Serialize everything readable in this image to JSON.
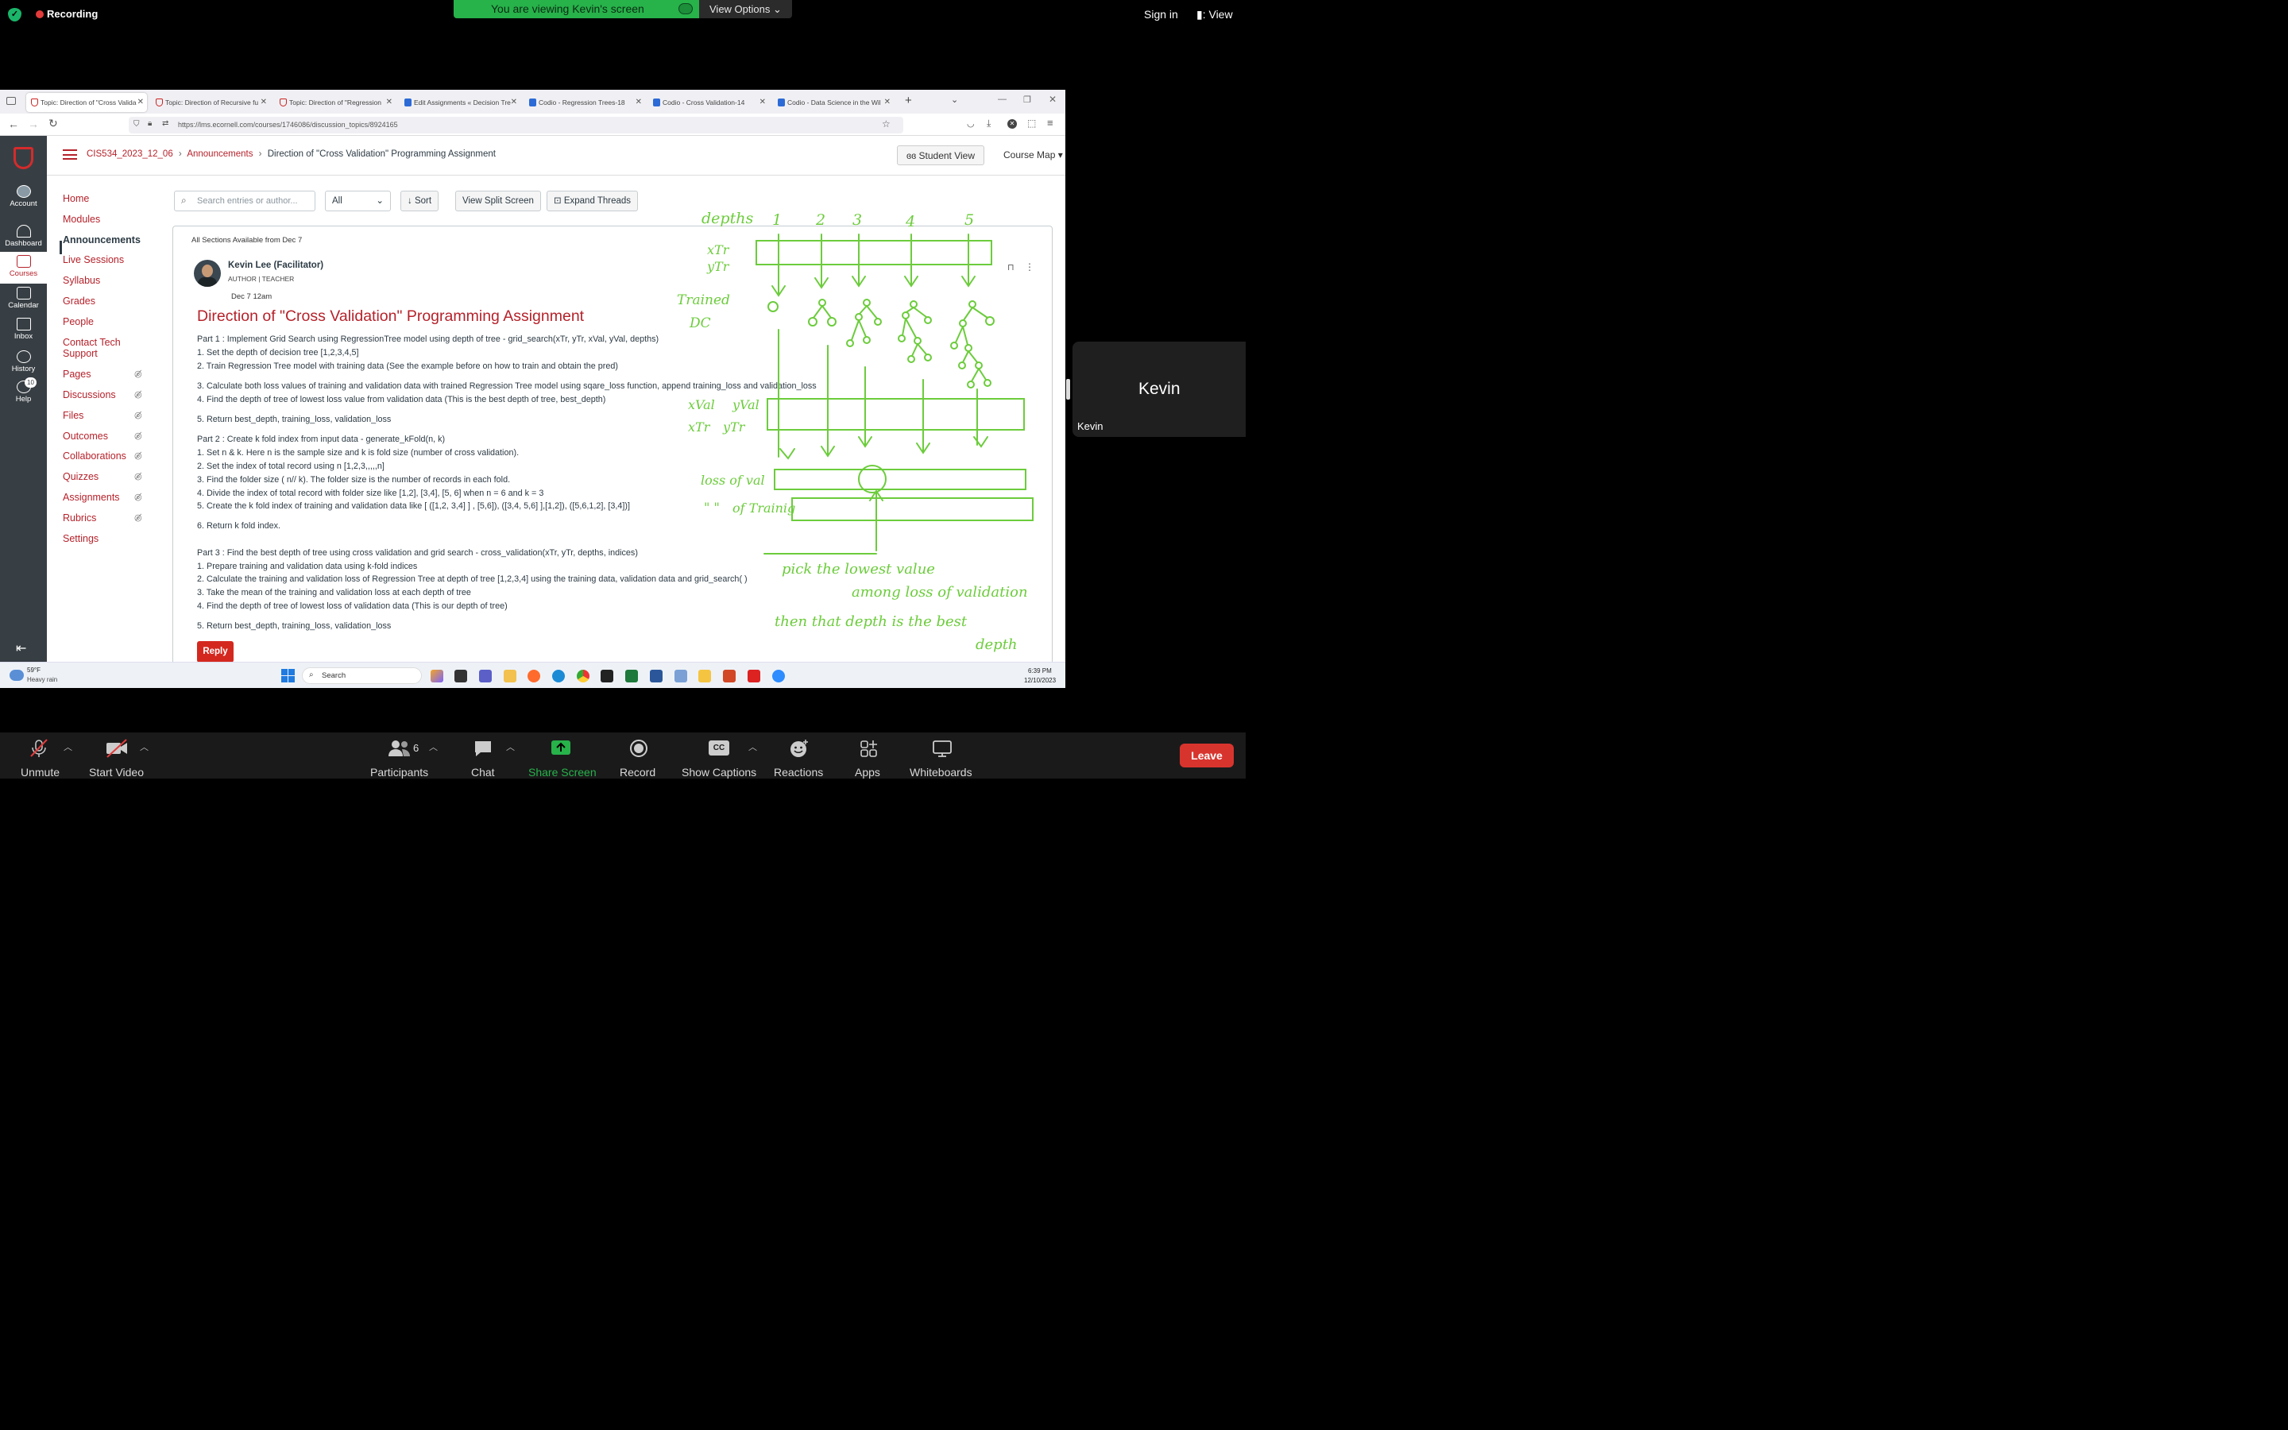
{
  "zoom": {
    "recording": "Recording",
    "banner": "You are viewing Kevin's screen",
    "view_options": "View Options",
    "sign_in": "Sign in",
    "view": "View",
    "kevin_tile_name": "Kevin",
    "kevin_tile_label": "Kevin",
    "controls": {
      "unmute": "Unmute",
      "start_video": "Start Video",
      "participants": "Participants",
      "participants_count": "6",
      "chat": "Chat",
      "share_screen": "Share Screen",
      "record": "Record",
      "show_captions": "Show Captions",
      "captions_badge": "CC",
      "reactions": "Reactions",
      "apps": "Apps",
      "whiteboards": "Whiteboards",
      "leave": "Leave"
    }
  },
  "browser": {
    "tabs": [
      {
        "label": "Topic: Direction of \"Cross Valida"
      },
      {
        "label": "Topic: Direction of Recursive fu"
      },
      {
        "label": "Topic: Direction of \"Regression"
      },
      {
        "label": "Edit Assignments « Decision Tre"
      },
      {
        "label": "Codio - Regression Trees-18"
      },
      {
        "label": "Codio - Cross Validation-14"
      },
      {
        "label": "Codio - Data Science in the Wil"
      }
    ],
    "url": "https://lms.ecornell.com/courses/1746086/discussion_topics/8924165"
  },
  "canvas": {
    "global_nav": [
      "Account",
      "Dashboard",
      "Courses",
      "Calendar",
      "Inbox",
      "History",
      "Help"
    ],
    "help_badge": "10",
    "breadcrumb": {
      "course": "CIS534_2023_12_06",
      "section": "Announcements",
      "page": "Direction of \"Cross Validation\" Programming Assignment"
    },
    "student_view": "Student View",
    "course_map": "Course Map",
    "course_nav": [
      {
        "label": "Home"
      },
      {
        "label": "Modules"
      },
      {
        "label": "Announcements"
      },
      {
        "label": "Live Sessions"
      },
      {
        "label": "Syllabus"
      },
      {
        "label": "Grades"
      },
      {
        "label": "People"
      },
      {
        "label": "Contact Tech Support"
      },
      {
        "label": "Pages"
      },
      {
        "label": "Discussions"
      },
      {
        "label": "Files"
      },
      {
        "label": "Outcomes"
      },
      {
        "label": "Collaborations"
      },
      {
        "label": "Quizzes"
      },
      {
        "label": "Assignments"
      },
      {
        "label": "Rubrics"
      },
      {
        "label": "Settings"
      }
    ],
    "toolbar": {
      "search_placeholder": "Search entries or author...",
      "filter_value": "All",
      "sort": "Sort",
      "split": "View Split Screen",
      "expand": "Expand Threads"
    },
    "post": {
      "sections": "All Sections Available from Dec 7",
      "author": "Kevin Lee (Facilitator)",
      "roles": "AUTHOR  |  TEACHER",
      "date": "Dec 7 12am",
      "title": "Direction of \"Cross Validation\" Programming Assignment",
      "lines": [
        "Part 1 : Implement Grid Search using RegressionTree model using depth of tree - grid_search(xTr, yTr, xVal, yVal, depths)",
        "1. Set the depth of decision tree [1,2,3,4,5]",
        "2. Train Regression Tree model with training data (See the example before on how to train and obtain the pred)",
        "3. Calculate both loss values of training and validation data with trained Regression Tree model using sqare_loss function, append training_loss and validation_loss",
        "4. Find the depth of tree of lowest loss value from validation data (This is the best depth of tree, best_depth)",
        "5. Return best_depth, training_loss, validation_loss",
        "Part 2 : Create k fold index from input data - generate_kFold(n, k)",
        "1. Set n & k.  Here n is the sample size and k is fold size (number of cross validation).",
        "2. Set the index of total record using n [1,2,3,,,,,n]",
        "3. Find the folder size ( n// k). The folder size is the number of records in each fold.",
        "4. Divide the index of total record with folder size like [1,2], [3,4], [5, 6] when  n = 6 and k = 3",
        "5. Create the k fold index of training and validation data like [ ([1,2, 3,4] ] , [5,6]), ([3,4, 5,6] ],[1,2]), ([5,6,1,2], [3,4])]",
        "6. Return k fold index.",
        "Part 3 : Find the best depth of tree using cross validation and grid search - cross_validation(xTr, yTr, depths, indices)",
        "1. Prepare training and validation data using k-fold indices",
        "2. Calculate the training and validation loss of Regression Tree at depth of tree [1,2,3,4] using the training data, validation data and grid_search( )",
        "3. Take the mean of  the training and validation loss at each depth of tree",
        "4. Find the depth of tree of lowest loss of validation data (This is our depth of tree)",
        "5. Return best_depth, training_loss, validation_loss"
      ],
      "reply": "Reply"
    }
  },
  "annotation": {
    "depths": "depths",
    "d1": "1",
    "d2": "2",
    "d3": "3",
    "d4": "4",
    "d5": "5",
    "xtr": "xTr",
    "ytr": "yTr",
    "trained": "Trained",
    "dc": "DC",
    "xval": "xVal",
    "yval": "yVal",
    "xtr2": "xTr",
    "ytr2": "yTr",
    "loss_val": "loss of val",
    "ditto": "\" \"",
    "of_training": "of Trainig",
    "note1": "pick  the  lowest  value",
    "note2": "among  loss of  validation",
    "note3": "then  that  depth  is   the  best",
    "note4": "depth"
  },
  "taskbar": {
    "temp": "59°F",
    "weather": "Heavy rain",
    "search": "Search",
    "time": "6:39 PM",
    "date": "12/10/2023"
  },
  "colors": {
    "canvas_red": "#b5222b",
    "zoom_green": "#27b24a",
    "annotation_green": "#6ccc3c",
    "leave_red": "#d8342e"
  }
}
